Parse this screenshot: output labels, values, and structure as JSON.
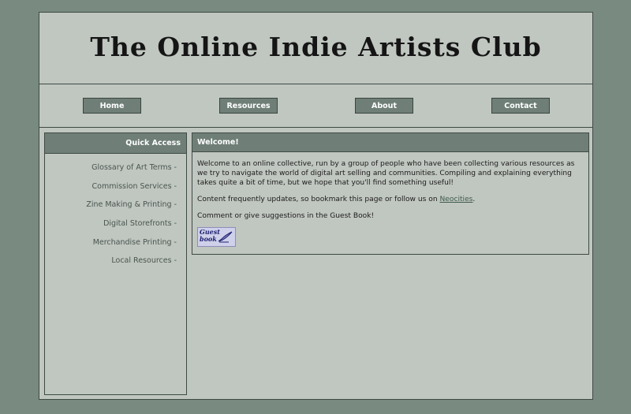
{
  "site": {
    "title": "The Online Indie Artists Club"
  },
  "nav": [
    {
      "label": "Home"
    },
    {
      "label": "Resources"
    },
    {
      "label": "About"
    },
    {
      "label": "Contact"
    }
  ],
  "sidebar": {
    "heading": "Quick Access",
    "items": [
      {
        "label": "Glossary of Art Terms -"
      },
      {
        "label": "Commission Services -"
      },
      {
        "label": "Zine Making & Printing -"
      },
      {
        "label": "Digital Storefronts -"
      },
      {
        "label": "Merchandise Printing -"
      },
      {
        "label": "Local Resources -"
      }
    ]
  },
  "main": {
    "heading": "Welcome!",
    "intro": "Welcome to an online collective, run by a group of people who have been collecting various resources as we try to navigate the world of digital art selling and communities. Compiling and explaining everything takes quite a bit of time, but we hope that you'll find something useful!",
    "updates_prefix": "Content frequently updates, so bookmark this page or follow us on ",
    "updates_link": "Neocities",
    "updates_suffix": ".",
    "guestbook_note": "Comment or give suggestions in the Guest Book!",
    "guestbook_button_text": "Guest\nbook",
    "guestbook_icon": "quill-pen-icon"
  },
  "colors": {
    "page_bg": "#798a81",
    "panel_bg": "#c0c6c0",
    "header_bar": "#6f7f78",
    "border": "#3e4a44",
    "link": "#3d5a4c"
  }
}
